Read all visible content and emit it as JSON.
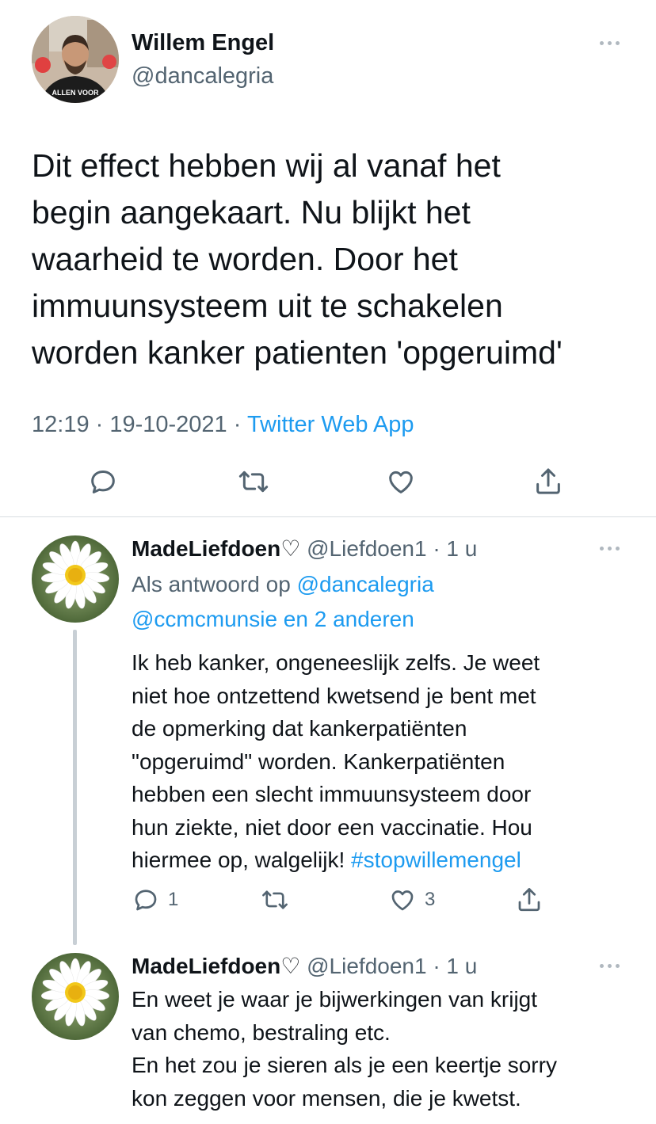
{
  "main_tweet": {
    "author_name": "Willem Engel",
    "author_handle": "@dancalegria",
    "avatar_shirt_text": "ALLEN VOOR",
    "text_lines": [
      "Dit effect hebben wij al vanaf het",
      "begin aangekaart. Nu blijkt het",
      "waarheid te worden. Door het",
      "immuunsysteem uit te schakelen",
      "worden kanker patienten 'opgeruimd'"
    ],
    "time": "12:19 · 19-10-2021 · ",
    "source": "Twitter Web App",
    "actions": [
      "reply-icon",
      "retweet-icon",
      "like-icon",
      "share-icon"
    ]
  },
  "replies": [
    {
      "name": "MadeLiefdoen♡",
      "handle_time": " @Liefdoen1 · 1 u",
      "reply_to_prefix": "Als antwoord op ",
      "reply_to_user": "@dancalegria",
      "reply_to_others": "@ccmcmunsie en 2 anderen",
      "text_lines": [
        "Ik heb kanker, ongeneeslijk zelfs. Je weet",
        "niet hoe ontzettend kwetsend je bent met",
        "de opmerking dat kankerpatiënten",
        "\"opgeruimd\" worden. Kankerpatiënten",
        "hebben een slecht immuunsysteem door",
        "hun ziekte, niet door een vaccinatie. Hou"
      ],
      "last_line_text": "hiermee op, walgelijk! ",
      "hashtag": "#stopwillemengel",
      "reply_count": "1",
      "like_count": "3"
    },
    {
      "name": "MadeLiefdoen♡",
      "handle_time": " @Liefdoen1 · 1 u",
      "text_lines": [
        "En weet je waar je bijwerkingen van krijgt",
        "van chemo, bestraling etc.",
        "En het zou je sieren als je een keertje sorry",
        "kon zeggen voor mensen, die je kwetst."
      ]
    }
  ],
  "colors": {
    "text": "#0f1419",
    "secondary": "#536471",
    "link": "#1d9bf0",
    "divider": "#d8dde1"
  }
}
